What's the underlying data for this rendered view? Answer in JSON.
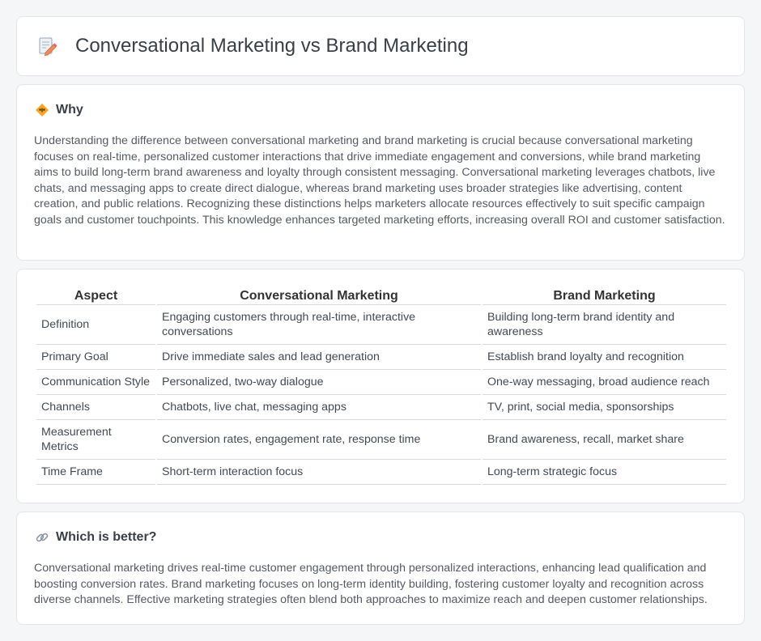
{
  "header": {
    "title": "Conversational Marketing vs Brand Marketing",
    "icon": "document-pencil-icon"
  },
  "why": {
    "heading": "Why",
    "icon": "diamond-sign-icon",
    "text": "Understanding the difference between conversational marketing and brand marketing is crucial because conversational marketing focuses on real-time, personalized customer interactions that drive immediate engagement and conversions, while brand marketing aims to build long-term brand awareness and loyalty through consistent messaging. Conversational marketing leverages chatbots, live chats, and messaging apps to create direct dialogue, whereas brand marketing uses broader strategies like advertising, content creation, and public relations. Recognizing these distinctions helps marketers allocate resources effectively to suit specific campaign goals and customer touchpoints. This knowledge enhances targeted marketing efforts, increasing overall ROI and customer satisfaction."
  },
  "comparison": {
    "headers": [
      "Aspect",
      "Conversational Marketing",
      "Brand Marketing"
    ],
    "rows": [
      [
        "Definition",
        "Engaging customers through real-time, interactive conversations",
        "Building long-term brand identity and awareness"
      ],
      [
        "Primary Goal",
        "Drive immediate sales and lead generation",
        "Establish brand loyalty and recognition"
      ],
      [
        "Communication Style",
        "Personalized, two-way dialogue",
        "One-way messaging, broad audience reach"
      ],
      [
        "Channels",
        "Chatbots, live chat, messaging apps",
        "TV, print, social media, sponsorships"
      ],
      [
        "Measurement Metrics",
        "Conversion rates, engagement rate, response time",
        "Brand awareness, recall, market share"
      ],
      [
        "Time Frame",
        "Short-term interaction focus",
        "Long-term strategic focus"
      ]
    ]
  },
  "better": {
    "heading": "Which is better?",
    "icon": "link-icon",
    "text": "Conversational marketing drives real-time customer engagement through personalized interactions, enhancing lead qualification and boosting conversion rates. Brand marketing focuses on long-term identity building, fostering customer loyalty and recognition across diverse channels. Effective marketing strategies often blend both approaches to maximize reach and deepen customer relationships."
  }
}
